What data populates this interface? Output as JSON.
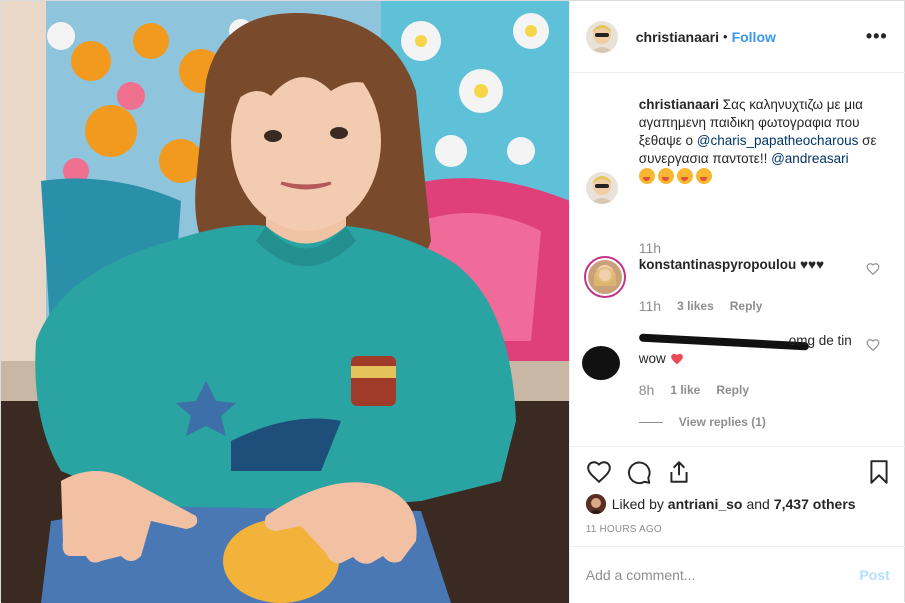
{
  "header": {
    "username": "christianaari",
    "separator": "•",
    "follow_label": "Follow",
    "more_icon": "more-options-icon"
  },
  "caption": {
    "username": "christianaari",
    "text_part1": "Σας καληνυχτιζω με μια αγαπημενη παιδικη φωτογραφια που ξεθαψε ο",
    "mention1": "@charis_papatheocharous",
    "text_part2": "σε συνεργασια παντοτε!!",
    "mention2": "@andreasari",
    "emoji_icon": "savoring-face-emoji",
    "emoji_count": 4,
    "time": "11h"
  },
  "comments": [
    {
      "username": "konstantinaspyropoulou",
      "text": "♥♥♥",
      "time": "11h",
      "likes": "3 likes",
      "reply_label": "Reply"
    },
    {
      "username": "",
      "text": "omg de tin wow",
      "time": "8h",
      "likes": "1 like",
      "reply_label": "Reply"
    }
  ],
  "view_replies": "View replies (1)",
  "likes": {
    "prefix": "Liked by",
    "name": "antriani_so",
    "and": "and",
    "others": "7,437 others"
  },
  "timestamp": "11 HOURS AGO",
  "add_comment": {
    "placeholder": "Add a comment...",
    "post_label": "Post"
  },
  "colors": {
    "link": "#3897f0",
    "mention": "#003569",
    "muted": "#8e8e8e",
    "post_disabled": "#b2dffc",
    "heart_red": "#ed4956"
  }
}
